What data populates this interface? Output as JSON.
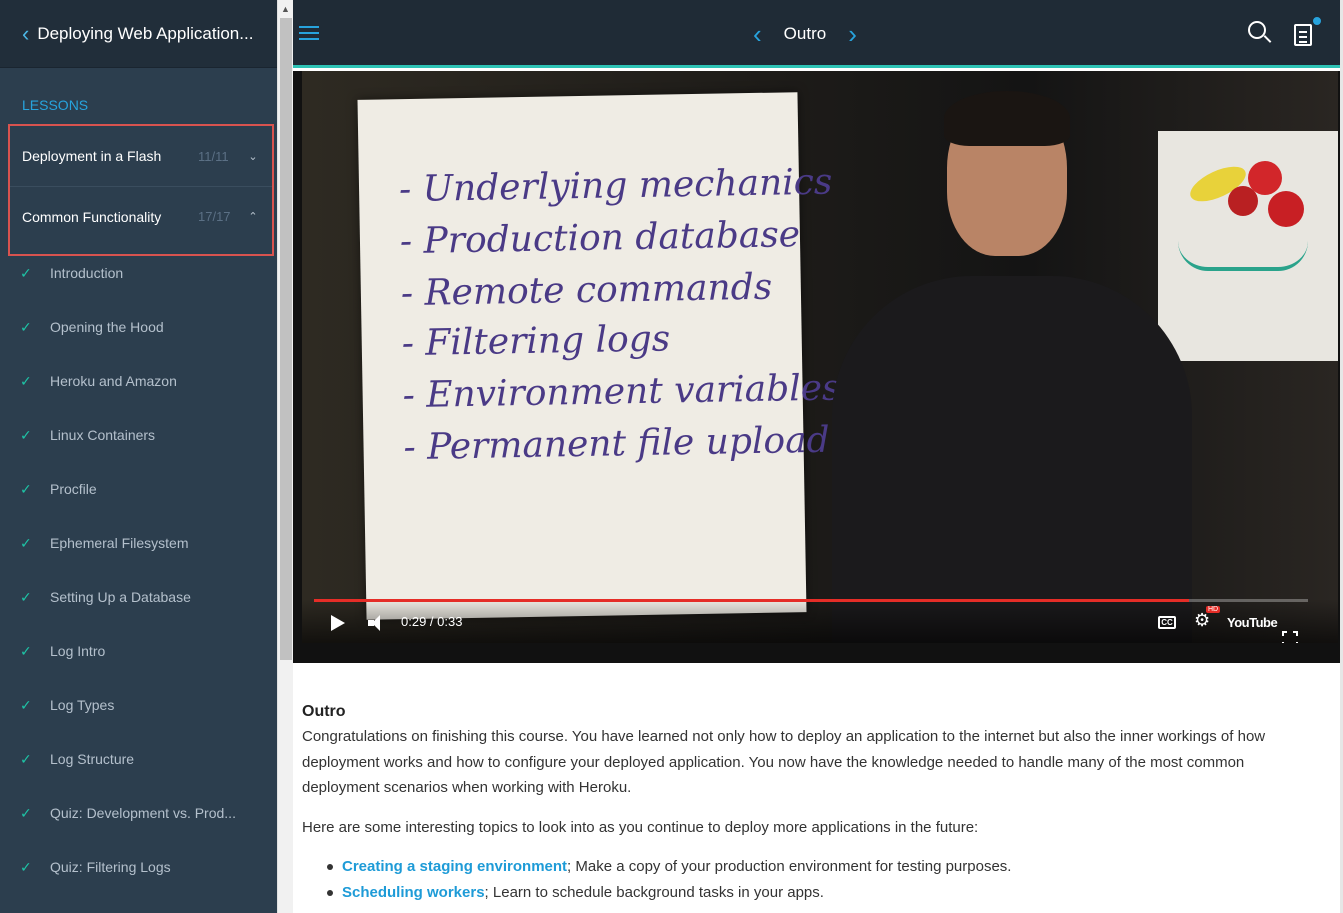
{
  "sidebar": {
    "course_title": "Deploying Web Application...",
    "section_label": "LESSONS",
    "lessons": [
      {
        "name": "Deployment in a Flash",
        "count": "11/11",
        "chevron": "⌄"
      },
      {
        "name": "Common Functionality",
        "count": "17/17",
        "chevron": "⌃"
      }
    ],
    "topics": [
      {
        "label": "Introduction"
      },
      {
        "label": "Opening the Hood"
      },
      {
        "label": "Heroku and Amazon"
      },
      {
        "label": "Linux Containers"
      },
      {
        "label": "Procfile"
      },
      {
        "label": "Ephemeral Filesystem"
      },
      {
        "label": "Setting Up a Database"
      },
      {
        "label": "Log Intro"
      },
      {
        "label": "Log Types"
      },
      {
        "label": "Log Structure"
      },
      {
        "label": "Quiz: Development vs. Prod..."
      },
      {
        "label": "Quiz: Filtering Logs"
      }
    ],
    "check_glyph": "✓"
  },
  "topbar": {
    "title": "Outro",
    "prev_glyph": "‹",
    "next_glyph": "›"
  },
  "video": {
    "board_lines": [
      "- Underlying mechanics",
      "- Production database",
      "- Remote commands",
      "- Filtering logs",
      "- Environment variables",
      "- Permanent file upload"
    ],
    "time": "0:29 / 0:33",
    "progress": 0.88,
    "cc_label": "CC",
    "hd_label": "HD",
    "youtube_label": "YouTube"
  },
  "content": {
    "heading": "Outro",
    "intro": "Congratulations on finishing this course. You have learned not only how to deploy an application to the internet but also the inner workings of how deployment works and how to configure your deployed application. You now have the knowledge needed to handle many of the most common deployment scenarios when working with Heroku.",
    "topics_intro": "Here are some interesting topics to look into as you continue to deploy more applications in the future:",
    "links": [
      {
        "link": "Creating a staging environment",
        "desc": "; Make a copy of your production environment for testing purposes."
      },
      {
        "link": "Scheduling workers",
        "desc": "; Learn to schedule background tasks in your apps."
      }
    ]
  },
  "colors": {
    "accent": "#27a3dd",
    "teal": "#2ec4b6",
    "sidebar_bg": "#2c3e4e",
    "highlight_border": "#d9534f",
    "progress_red": "#e52d27"
  }
}
